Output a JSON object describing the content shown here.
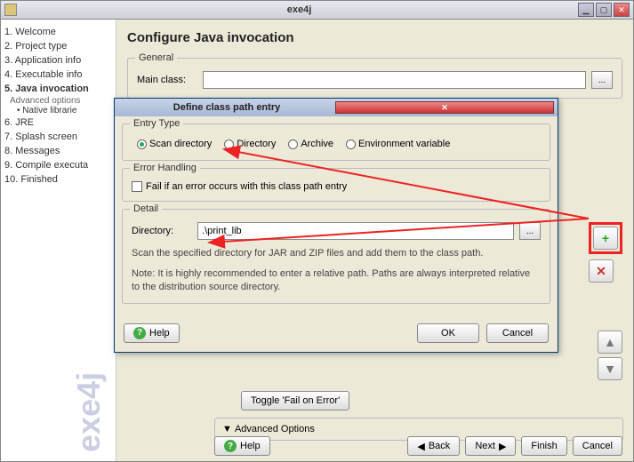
{
  "window": {
    "title": "exe4j"
  },
  "sidebar": {
    "steps": [
      "1. Welcome",
      "2. Project type",
      "3. Application info",
      "4. Executable info",
      "5. Java invocation",
      "6. JRE",
      "7. Splash screen",
      "8. Messages",
      "9. Compile executa",
      "10. Finished"
    ],
    "advanced_label": "Advanced options",
    "native_label": "Native librarie",
    "watermark": "exe4j"
  },
  "content": {
    "heading": "Configure Java invocation",
    "general_legend": "General",
    "main_class_label": "Main class:",
    "main_class_value": "",
    "browse": "...",
    "toggle_fail": "Toggle 'Fail on Error'",
    "advanced_options": "Advanced Options",
    "buttons": {
      "help": "Help",
      "back": "Back",
      "next": "Next",
      "finish": "Finish",
      "cancel": "Cancel"
    },
    "icons": {
      "add": "+",
      "del": "✕",
      "up": "▲",
      "down": "▼",
      "tri_left": "◀",
      "tri_right": "▶",
      "tri_down": "▼"
    }
  },
  "dialog": {
    "title": "Define class path entry",
    "entry_type_legend": "Entry Type",
    "radios": {
      "scan": "Scan directory",
      "directory": "Directory",
      "archive": "Archive",
      "env": "Environment variable"
    },
    "error_legend": "Error Handling",
    "fail_checkbox": "Fail if an error occurs with this class path entry",
    "detail_legend": "Detail",
    "directory_label": "Directory:",
    "directory_value": ".\\print_lib",
    "browse": "...",
    "desc1": "Scan the specified directory for JAR and ZIP files and add them to the class path.",
    "desc2": "Note: It is highly recommended to enter a relative path. Paths are always interpreted relative to the distribution source directory.",
    "help": "Help",
    "ok": "OK",
    "cancel": "Cancel"
  }
}
